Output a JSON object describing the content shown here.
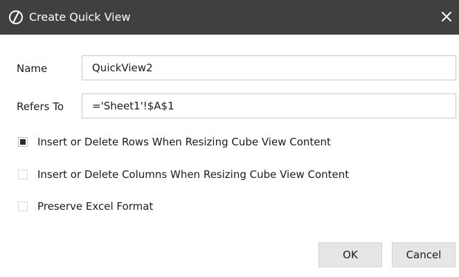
{
  "window": {
    "title": "Create Quick View",
    "logo_icon": "onestream-logo-icon",
    "close_icon": "close-icon",
    "titlebar_color": "#404040"
  },
  "form": {
    "name_label": "Name",
    "name_value": "QuickView2",
    "refers_to_label": "Refers To",
    "refers_to_value": "='Sheet1'!$A$1"
  },
  "options": [
    {
      "label": "Insert or Delete Rows When Resizing Cube View Content",
      "checked": true
    },
    {
      "label": "Insert or Delete Columns When Resizing Cube View Content",
      "checked": false
    },
    {
      "label": "Preserve Excel Format",
      "checked": false
    }
  ],
  "buttons": {
    "ok_label": "OK",
    "cancel_label": "Cancel"
  }
}
